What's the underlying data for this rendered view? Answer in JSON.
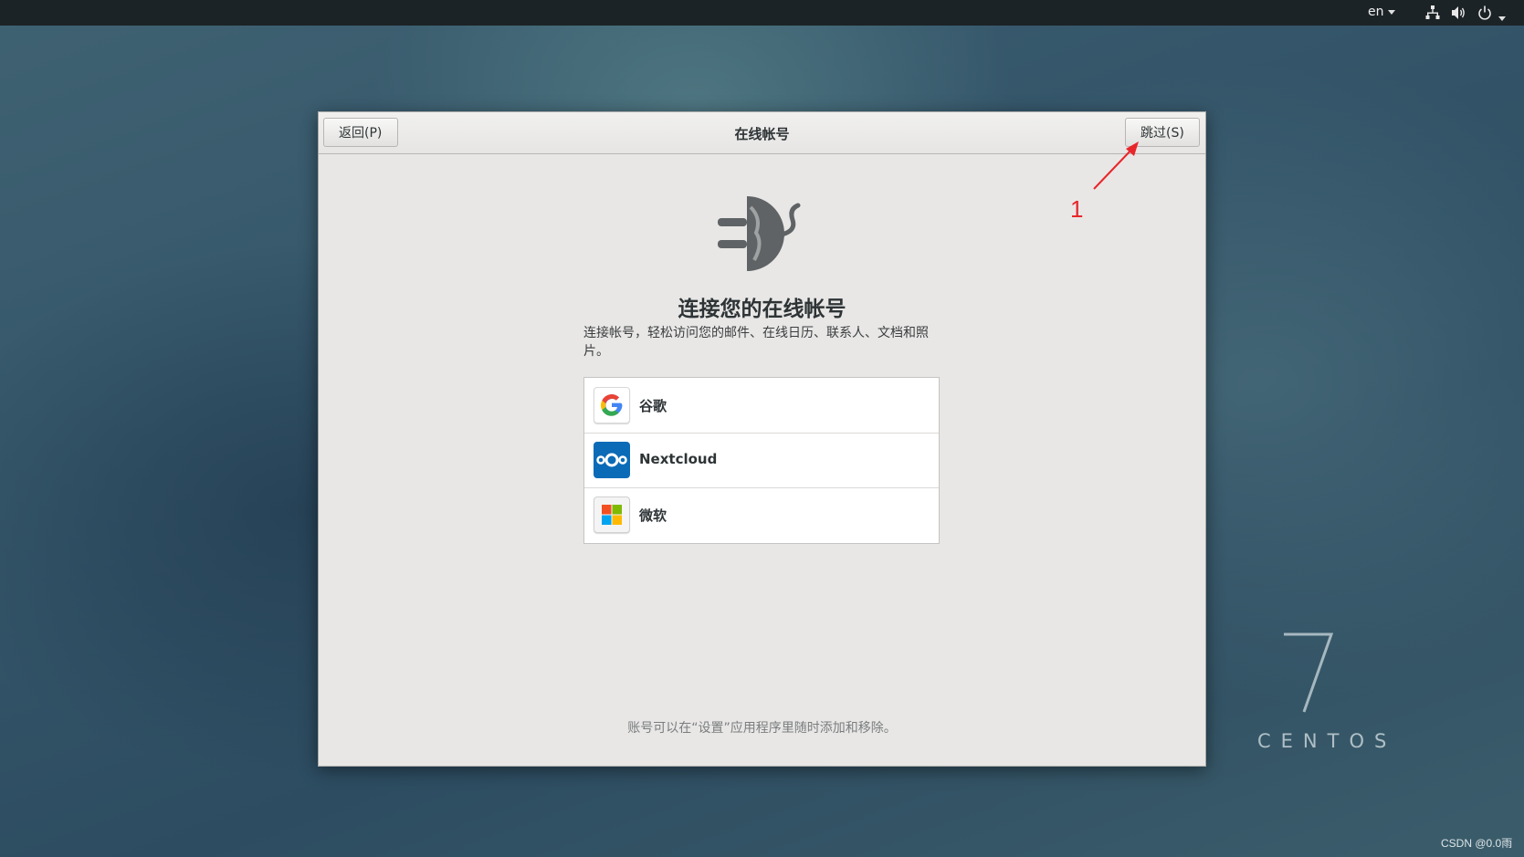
{
  "topbar": {
    "language": "en",
    "icons": [
      "network-icon",
      "volume-icon",
      "power-icon",
      "system-menu-caret-icon"
    ]
  },
  "dialog": {
    "title": "在线帐号",
    "back_label": "返回(P)",
    "skip_label": "跳过(S)",
    "hero_icon": "online-accounts-plug-globe-icon",
    "heading": "连接您的在线帐号",
    "description": "连接帐号，轻松访问您的邮件、在线日历、联系人、文档和照片。",
    "providers": [
      {
        "label": "谷歌",
        "icon": "google-icon"
      },
      {
        "label": "Nextcloud",
        "icon": "nextcloud-icon"
      },
      {
        "label": "微软",
        "icon": "microsoft-icon"
      }
    ],
    "footer_note": "账号可以在“设置”应用程序里随时添加和移除。"
  },
  "annotation": {
    "number": "1",
    "color": "#e8262a"
  },
  "wallpaper": {
    "version": "7",
    "brand": "CENTOS"
  },
  "credit": "CSDN @0.0雨"
}
